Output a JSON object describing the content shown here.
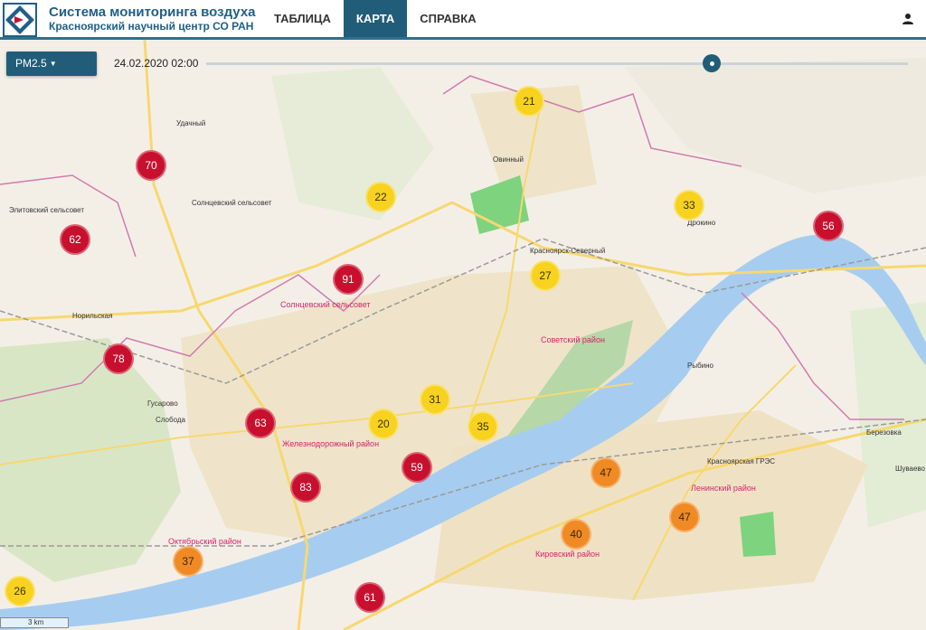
{
  "header": {
    "title": "Система мониторинга воздуха",
    "subtitle": "Красноярский научный центр СО РАН",
    "tabs": [
      {
        "label": "ТАБЛИЦА",
        "active": false
      },
      {
        "label": "КАРТА",
        "active": true
      },
      {
        "label": "СПРАВКА",
        "active": false
      }
    ],
    "user_icon": "user-icon"
  },
  "controls": {
    "pollutant": "PM2.5",
    "datetime": "24.02.2020 02:00"
  },
  "colors": {
    "accent": "#215d79",
    "red": "#c8102e",
    "orange": "#f08a24",
    "yellow": "#f7d21e"
  },
  "markers": [
    {
      "value": "21",
      "level": "yellow"
    },
    {
      "value": "70",
      "level": "red"
    },
    {
      "value": "22",
      "level": "yellow"
    },
    {
      "value": "33",
      "level": "yellow"
    },
    {
      "value": "62",
      "level": "red"
    },
    {
      "value": "56",
      "level": "red"
    },
    {
      "value": "91",
      "level": "red"
    },
    {
      "value": "27",
      "level": "yellow"
    },
    {
      "value": "78",
      "level": "red"
    },
    {
      "value": "31",
      "level": "yellow"
    },
    {
      "value": "63",
      "level": "red"
    },
    {
      "value": "20",
      "level": "yellow"
    },
    {
      "value": "35",
      "level": "yellow"
    },
    {
      "value": "59",
      "level": "red"
    },
    {
      "value": "47",
      "level": "orange"
    },
    {
      "value": "83",
      "level": "red"
    },
    {
      "value": "47",
      "level": "orange"
    },
    {
      "value": "40",
      "level": "orange"
    },
    {
      "value": "37",
      "level": "orange"
    },
    {
      "value": "26",
      "level": "yellow"
    },
    {
      "value": "61",
      "level": "red"
    }
  ],
  "map_labels": {
    "l1": "Солнцевский сельсовет",
    "l2": "Солнцевский сельсовет",
    "l3": "Советский район",
    "l4": "Железнодорожный район",
    "l5": "Октябрьский район",
    "l6": "Кировский район",
    "l7": "Ленинский район",
    "l8": "Удачный",
    "l9": "Овинный",
    "l10": "Элитовский сельсовет",
    "l11": "Норильская",
    "l12": "Гусарово",
    "l13": "Слобода",
    "l14": "Березовка",
    "l15": "Рыбино",
    "l16": "Дрокино",
    "l17": "Шуваево",
    "l18": "Красноярск-Северный",
    "l19": "Красноярская ГРЭС"
  },
  "scale_label": "3 km"
}
